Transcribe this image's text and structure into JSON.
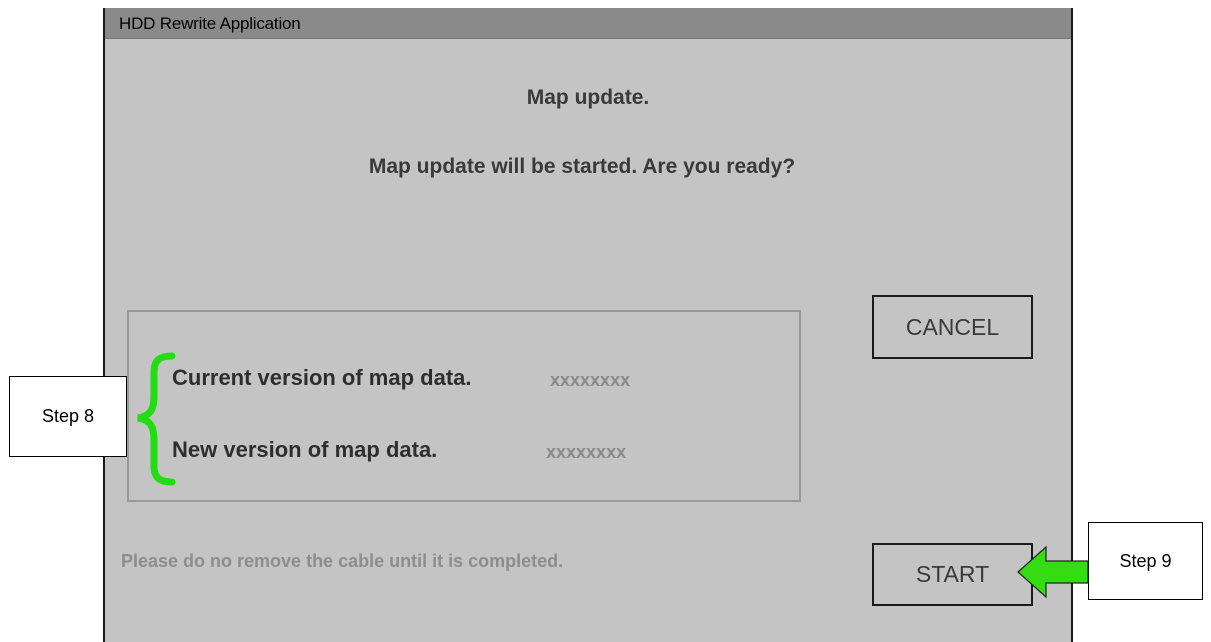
{
  "window": {
    "title": "HDD Rewrite Application"
  },
  "dialog": {
    "heading": "Map update.",
    "prompt": "Map update will be started. Are you ready?",
    "current_label": "Current version of map data.",
    "current_value": "xxxxxxxx",
    "new_label": "New version of map data.",
    "new_value": "xxxxxxxx",
    "notice": "Please do no remove the cable until it is completed."
  },
  "buttons": {
    "cancel": "CANCEL",
    "start": "START"
  },
  "annotations": {
    "step8": "Step 8",
    "step9": "Step 9"
  },
  "colors": {
    "bracket": "#22dd11",
    "arrow": "#33dd11",
    "window_bg": "#c4c4c4",
    "titlebar": "#8a8a8a"
  }
}
